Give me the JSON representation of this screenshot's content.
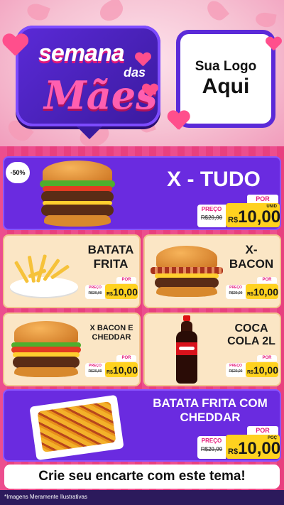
{
  "header": {
    "title_line1": "semana",
    "title_line2": "das",
    "title_line3": "Mães",
    "logo_line1": "Sua Logo",
    "logo_line2": "Aqui"
  },
  "products": [
    {
      "name": "X - TUDO",
      "por": "POR",
      "preco_label": "PREÇO",
      "old_price": "R$20,00",
      "currency": "R$",
      "price": "10,00",
      "unit": "UNID",
      "discount": "-50%",
      "icon": "burger-icon"
    },
    {
      "name": "BATATA FRITA",
      "por": "POR",
      "preco_label": "PREÇO",
      "old_price": "R$20,00",
      "currency": "R$",
      "price": "10,00",
      "icon": "fries-icon"
    },
    {
      "name": "X-BACON",
      "por": "POR",
      "preco_label": "PREÇO",
      "old_price": "R$20,00",
      "currency": "R$",
      "price": "10,00",
      "icon": "bacon-burger-icon"
    },
    {
      "name": "X BACON E CHEDDAR",
      "por": "POR",
      "preco_label": "PREÇO",
      "old_price": "R$20,00",
      "currency": "R$",
      "price": "10,00",
      "icon": "cheddar-burger-icon"
    },
    {
      "name": "COCA COLA 2L",
      "por": "POR",
      "preco_label": "PREÇO",
      "old_price": "R$20,00",
      "currency": "R$",
      "price": "10,00",
      "icon": "soda-bottle-icon"
    },
    {
      "name": "BATATA FRITA COM CHEDDAR",
      "por": "POR",
      "preco_label": "PREÇO",
      "old_price": "R$20,00",
      "currency": "R$",
      "price": "10,00",
      "unit": "POÇ",
      "icon": "cheddar-fries-icon"
    }
  ],
  "cta": "Crie seu encarte com este tema!",
  "footer": "*Imagens Meramente Ilustrativas",
  "colors": {
    "purple": "#6a2be0",
    "peach": "#fbe6c5",
    "pink": "#ec4e8e",
    "yellow": "#ffd21f",
    "magenta": "#e4197a"
  }
}
